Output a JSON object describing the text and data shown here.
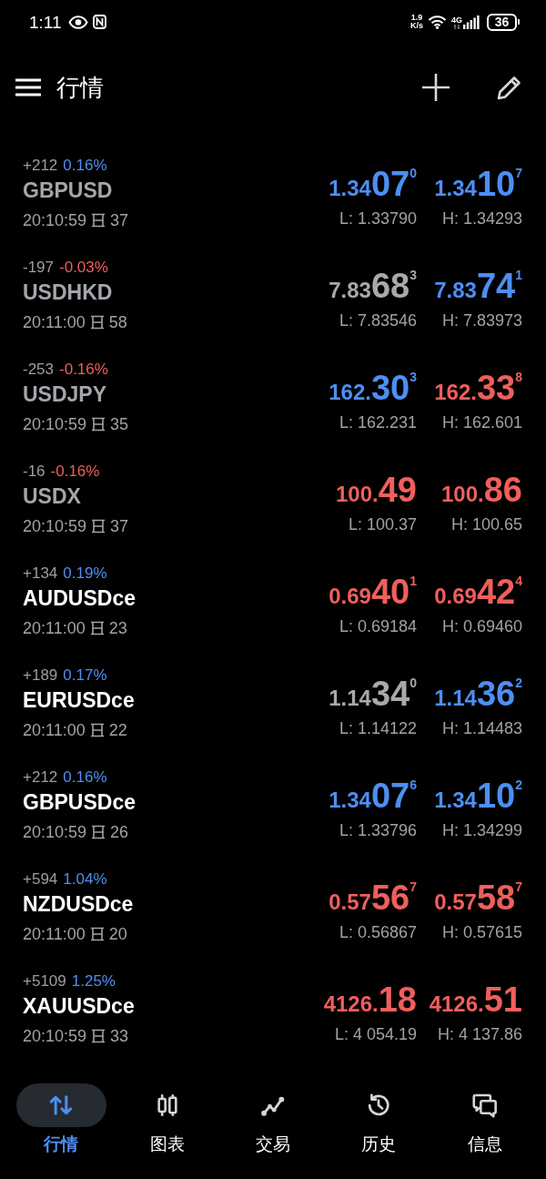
{
  "status_bar": {
    "time": "1:11",
    "net_speed": "1.9",
    "net_speed_unit": "K/s",
    "network": "4G",
    "battery": "36"
  },
  "header": {
    "title": "行情"
  },
  "quotes": [
    {
      "change": {
        "points": "+212",
        "percent": "0.16%",
        "color": "#4d8ff3"
      },
      "symbol": "GBPUSD",
      "disabled": true,
      "time": "20:10:59",
      "spread": "37",
      "bid": {
        "prefix": "1.34",
        "main": "07",
        "pip": "0",
        "color": "#4d8ff3"
      },
      "ask": {
        "prefix": "1.34",
        "main": "10",
        "pip": "7",
        "color": "#4d8ff3"
      },
      "low": "L: 1.33790",
      "high": "H: 1.34293"
    },
    {
      "change": {
        "points": "-197",
        "percent": "-0.03%",
        "color": "#ef5f5c"
      },
      "symbol": "USDHKD",
      "disabled": true,
      "time": "20:11:00",
      "spread": "58",
      "bid": {
        "prefix": "7.83",
        "main": "68",
        "pip": "3",
        "color": "#a7a9ac"
      },
      "ask": {
        "prefix": "7.83",
        "main": "74",
        "pip": "1",
        "color": "#4d8ff3"
      },
      "low": "L: 7.83546",
      "high": "H: 7.83973"
    },
    {
      "change": {
        "points": "-253",
        "percent": "-0.16%",
        "color": "#ef5f5c"
      },
      "symbol": "USDJPY",
      "disabled": true,
      "time": "20:10:59",
      "spread": "35",
      "bid": {
        "prefix": "162.",
        "main": "30",
        "pip": "3",
        "color": "#4d8ff3"
      },
      "ask": {
        "prefix": "162.",
        "main": "33",
        "pip": "8",
        "color": "#ef5f5c"
      },
      "low": "L: 162.231",
      "high": "H: 162.601"
    },
    {
      "change": {
        "points": "-16",
        "percent": "-0.16%",
        "color": "#ef5f5c"
      },
      "symbol": "USDX",
      "disabled": true,
      "time": "20:10:59",
      "spread": "37",
      "bid": {
        "prefix": "100.",
        "main": "49",
        "color": "#ef5f5c"
      },
      "ask": {
        "prefix": "100.",
        "main": "86",
        "color": "#ef5f5c"
      },
      "low": "L: 100.37",
      "high": "H: 100.65"
    },
    {
      "change": {
        "points": "+134",
        "percent": "0.19%",
        "color": "#4d8ff3"
      },
      "symbol": "AUDUSDce",
      "disabled": false,
      "time": "20:11:00",
      "spread": "23",
      "bid": {
        "prefix": "0.69",
        "main": "40",
        "pip": "1",
        "color": "#ef5f5c"
      },
      "ask": {
        "prefix": "0.69",
        "main": "42",
        "pip": "4",
        "color": "#ef5f5c"
      },
      "low": "L: 0.69184",
      "high": "H: 0.69460"
    },
    {
      "change": {
        "points": "+189",
        "percent": "0.17%",
        "color": "#4d8ff3"
      },
      "symbol": "EURUSDce",
      "disabled": false,
      "time": "20:11:00",
      "spread": "22",
      "bid": {
        "prefix": "1.14",
        "main": "34",
        "pip": "0",
        "color": "#a7a9ac"
      },
      "ask": {
        "prefix": "1.14",
        "main": "36",
        "pip": "2",
        "color": "#4d8ff3"
      },
      "low": "L: 1.14122",
      "high": "H: 1.14483"
    },
    {
      "change": {
        "points": "+212",
        "percent": "0.16%",
        "color": "#4d8ff3"
      },
      "symbol": "GBPUSDce",
      "disabled": false,
      "time": "20:10:59",
      "spread": "26",
      "bid": {
        "prefix": "1.34",
        "main": "07",
        "pip": "6",
        "color": "#4d8ff3"
      },
      "ask": {
        "prefix": "1.34",
        "main": "10",
        "pip": "2",
        "color": "#4d8ff3"
      },
      "low": "L: 1.33796",
      "high": "H: 1.34299"
    },
    {
      "change": {
        "points": "+594",
        "percent": "1.04%",
        "color": "#4d8ff3"
      },
      "symbol": "NZDUSDce",
      "disabled": false,
      "time": "20:11:00",
      "spread": "20",
      "bid": {
        "prefix": "0.57",
        "main": "56",
        "pip": "7",
        "color": "#ef5f5c"
      },
      "ask": {
        "prefix": "0.57",
        "main": "58",
        "pip": "7",
        "color": "#ef5f5c"
      },
      "low": "L: 0.56867",
      "high": "H: 0.57615"
    },
    {
      "change": {
        "points": "+5109",
        "percent": "1.25%",
        "color": "#4d8ff3"
      },
      "symbol": "XAUUSDce",
      "disabled": false,
      "time": "20:10:59",
      "spread": "33",
      "bid": {
        "prefix": "4126.",
        "main": "18",
        "color": "#ef5f5c"
      },
      "ask": {
        "prefix": "4126.",
        "main": "51",
        "color": "#ef5f5c"
      },
      "low": "L: 4 054.19",
      "high": "H: 4 137.86"
    }
  ],
  "bottom_nav": [
    {
      "label": "行情",
      "selected": true
    },
    {
      "label": "图表",
      "selected": false
    },
    {
      "label": "交易",
      "selected": false
    },
    {
      "label": "历史",
      "selected": false
    },
    {
      "label": "信息",
      "selected": false
    }
  ]
}
